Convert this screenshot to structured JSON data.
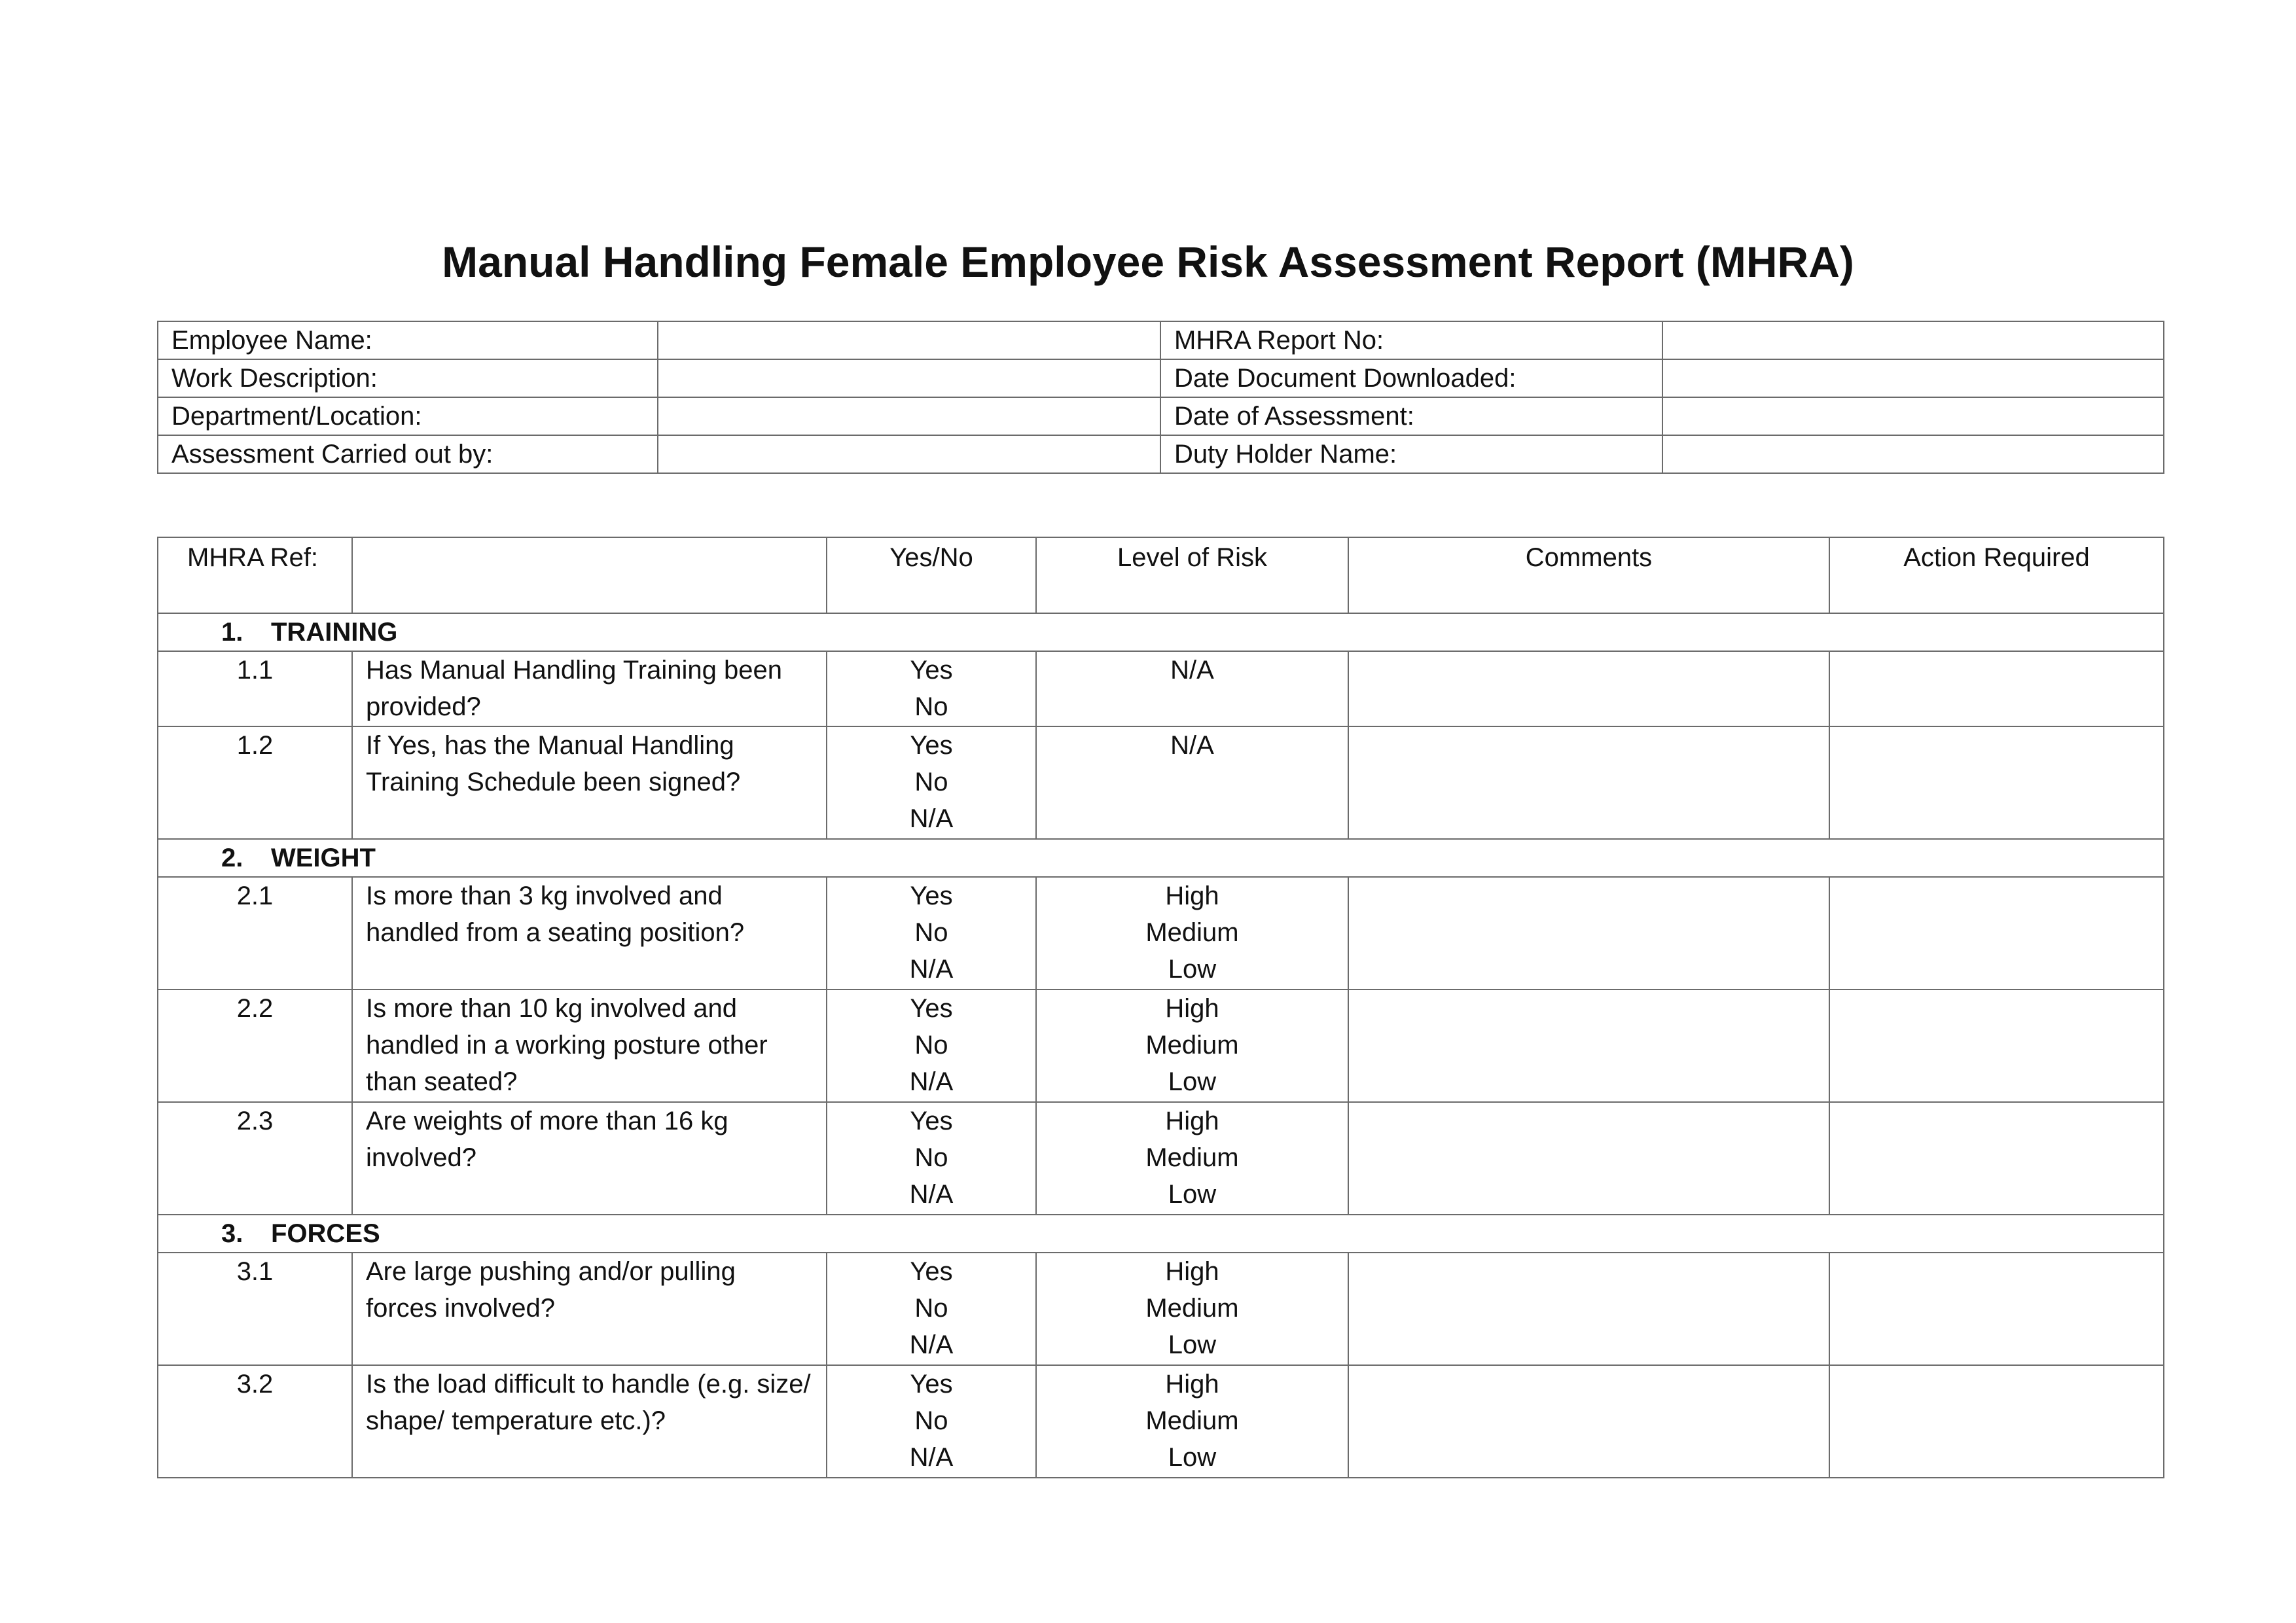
{
  "title": "Manual Handling Female Employee Risk Assessment Report (MHRA)",
  "info_fields": [
    {
      "left": "Employee Name:",
      "right": "MHRA Report No:"
    },
    {
      "left": "Work Description:",
      "right": "Date Document Downloaded:"
    },
    {
      "left": "Department/Location:",
      "right": "Date of Assessment:"
    },
    {
      "left": "Assessment Carried out by:",
      "right": "Duty Holder Name:"
    }
  ],
  "table_headers": {
    "ref": "MHRA Ref:",
    "question": "",
    "yes_no": "Yes/No",
    "level_of_risk": "Level of Risk",
    "comments": "Comments",
    "action_required": "Action Required"
  },
  "sections": [
    {
      "number": "1.",
      "name": "TRAINING",
      "rows": [
        {
          "ref": "1.1",
          "question": "Has Manual Handling Training been provided?",
          "yes_no": [
            "Yes",
            "No"
          ],
          "risk": [
            "N/A"
          ]
        },
        {
          "ref": "1.2",
          "question": "If Yes, has the Manual Handling Training Schedule been signed?",
          "yes_no": [
            "Yes",
            "No",
            "N/A"
          ],
          "risk": [
            "N/A"
          ]
        }
      ]
    },
    {
      "number": "2.",
      "name": "WEIGHT",
      "rows": [
        {
          "ref": "2.1",
          "question": "Is more than 3 kg involved and handled from a seating position?",
          "yes_no": [
            "Yes",
            "No",
            "N/A"
          ],
          "risk": [
            "High",
            "Medium",
            "Low"
          ]
        },
        {
          "ref": "2.2",
          "question": "Is more than 10 kg involved and handled in a working posture other than seated?",
          "yes_no": [
            "Yes",
            "No",
            "N/A"
          ],
          "risk": [
            "High",
            "Medium",
            "Low"
          ]
        },
        {
          "ref": "2.3",
          "question": "Are weights of more than 16 kg involved?",
          "yes_no": [
            "Yes",
            "No",
            "N/A"
          ],
          "risk": [
            "High",
            "Medium",
            "Low"
          ]
        }
      ]
    },
    {
      "number": "3.",
      "name": "FORCES",
      "rows": [
        {
          "ref": "3.1",
          "question": "Are large pushing and/or pulling forces involved?",
          "yes_no": [
            "Yes",
            "No",
            "N/A"
          ],
          "risk": [
            "High",
            "Medium",
            "Low"
          ]
        },
        {
          "ref": "3.2",
          "question": "Is the load difficult to handle (e.g. size/ shape/ temperature etc.)?",
          "yes_no": [
            "Yes",
            "No",
            "N/A"
          ],
          "risk": [
            "High",
            "Medium",
            "Low"
          ]
        }
      ]
    }
  ]
}
